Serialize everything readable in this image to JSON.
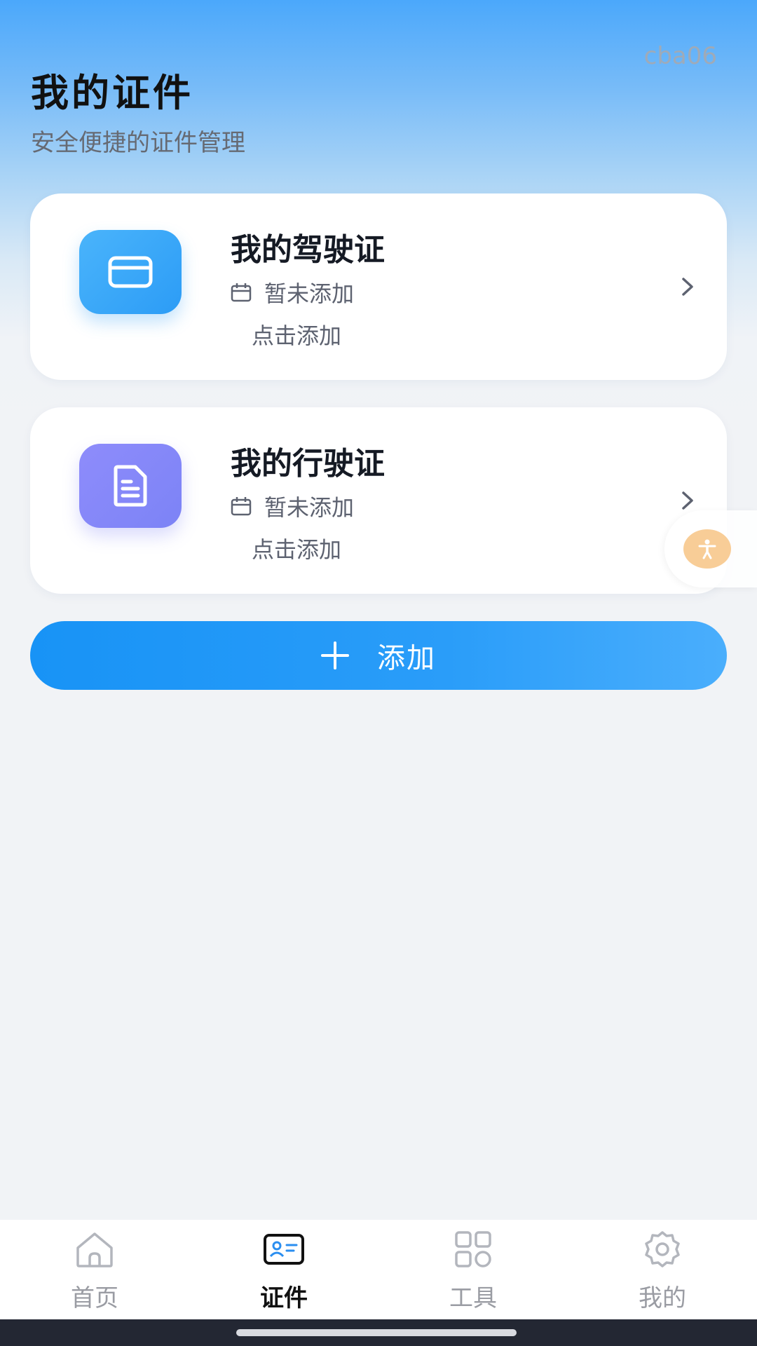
{
  "watermark": "cba06",
  "header": {
    "title": "我的证件",
    "subtitle": "安全便捷的证件管理"
  },
  "cards": [
    {
      "title": "我的驾驶证",
      "status": "暂未添加",
      "action": "点击添加",
      "icon": "credit-card-icon",
      "color": "#3aa8f9"
    },
    {
      "title": "我的行驶证",
      "status": "暂未添加",
      "action": "点击添加",
      "icon": "document-icon",
      "color": "#8a89f9"
    }
  ],
  "add_button": {
    "label": "添加",
    "icon": "plus-icon"
  },
  "accessibility_icon": "accessibility-icon",
  "tabbar": {
    "active_index": 1,
    "items": [
      {
        "label": "首页",
        "icon": "home-icon"
      },
      {
        "label": "证件",
        "icon": "id-card-icon"
      },
      {
        "label": "工具",
        "icon": "grid-icon"
      },
      {
        "label": "我的",
        "icon": "gear-icon"
      }
    ]
  },
  "colors": {
    "accent": "#1b95f7",
    "header_gradient_top": "#4ba8fb",
    "background": "#f1f3f6",
    "accessibility_button": "#f8cd97"
  }
}
